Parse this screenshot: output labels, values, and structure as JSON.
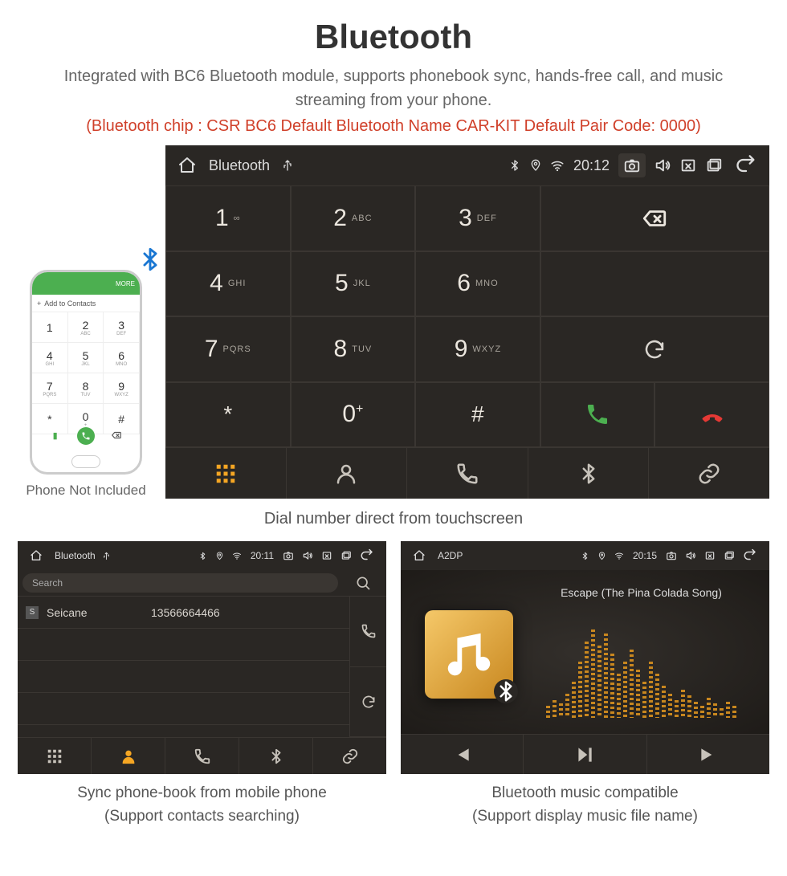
{
  "title": "Bluetooth",
  "intro": "Integrated with BC6 Bluetooth module, supports phonebook sync, hands-free call, and music streaming from your phone.",
  "spec_line": "(Bluetooth chip : CSR BC6     Default Bluetooth Name CAR-KIT     Default Pair Code: 0000)",
  "phone_mock": {
    "add_contacts": "Add to Contacts",
    "more": "MORE",
    "keys": [
      {
        "n": "1",
        "l": ""
      },
      {
        "n": "2",
        "l": "ABC"
      },
      {
        "n": "3",
        "l": "DEF"
      },
      {
        "n": "4",
        "l": "GHI"
      },
      {
        "n": "5",
        "l": "JKL"
      },
      {
        "n": "6",
        "l": "MNO"
      },
      {
        "n": "7",
        "l": "PQRS"
      },
      {
        "n": "8",
        "l": "TUV"
      },
      {
        "n": "9",
        "l": "WXYZ"
      },
      {
        "n": "*",
        "l": ""
      },
      {
        "n": "0",
        "l": "+"
      },
      {
        "n": "#",
        "l": ""
      }
    ],
    "caption": "Phone Not Included"
  },
  "dialer": {
    "status": {
      "title": "Bluetooth",
      "time": "20:12"
    },
    "keys": [
      {
        "n": "1",
        "l": "∞"
      },
      {
        "n": "2",
        "l": "ABC"
      },
      {
        "n": "3",
        "l": "DEF"
      },
      {
        "n": "4",
        "l": "GHI"
      },
      {
        "n": "5",
        "l": "JKL"
      },
      {
        "n": "6",
        "l": "MNO"
      },
      {
        "n": "7",
        "l": "PQRS"
      },
      {
        "n": "8",
        "l": "TUV"
      },
      {
        "n": "9",
        "l": "WXYZ"
      },
      {
        "n": "*",
        "l": ""
      },
      {
        "n": "0",
        "l": "+",
        "plus": true
      },
      {
        "n": "#",
        "l": ""
      }
    ],
    "caption": "Dial number direct from touchscreen"
  },
  "phonebook": {
    "status": {
      "title": "Bluetooth",
      "time": "20:11"
    },
    "search": "Search",
    "contact": {
      "tag": "S",
      "name": "Seicane",
      "number": "13566664466"
    },
    "caption_l1": "Sync phone-book from mobile phone",
    "caption_l2": "(Support contacts searching)"
  },
  "music": {
    "status": {
      "title": "A2DP",
      "time": "20:15"
    },
    "song": "Escape (The Pina Colada Song)",
    "caption_l1": "Bluetooth music compatible",
    "caption_l2": "(Support display music file name)"
  }
}
